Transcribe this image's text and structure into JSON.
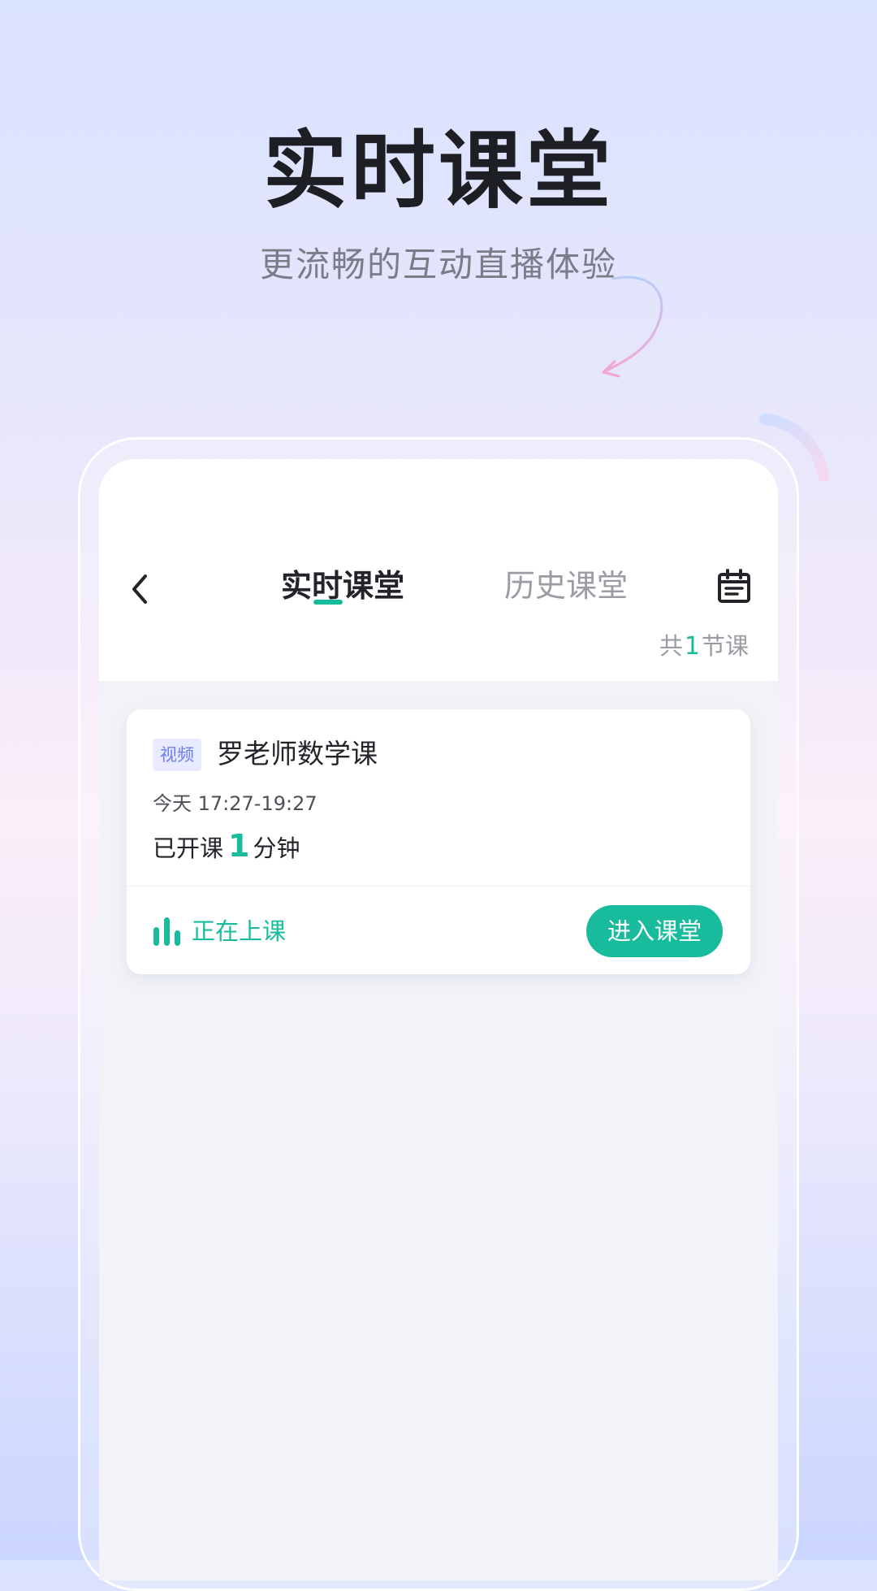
{
  "hero": {
    "title": "实时课堂",
    "subtitle": "更流畅的互动直播体验"
  },
  "colors": {
    "accent": "#18bc9c",
    "badge_bg": "#e8ebff",
    "badge_text": "#6d7df0",
    "title_text": "#1e1f24"
  },
  "header": {
    "tabs": [
      {
        "label": "实时课堂",
        "active": true
      },
      {
        "label": "历史课堂",
        "active": false
      }
    ],
    "back_icon": "chevron-left-icon",
    "calendar_icon": "calendar-icon"
  },
  "summary": {
    "prefix": "共",
    "count": "1",
    "suffix": "节课"
  },
  "course": {
    "type_badge": "视频",
    "title": "罗老师数学课",
    "time": "今天 17:27-19:27",
    "elapsed_prefix": "已开课",
    "elapsed_minutes": "1",
    "elapsed_suffix": "分钟",
    "status_icon": "live-bars-icon",
    "status_label": "正在上课",
    "enter_button": "进入课堂"
  }
}
